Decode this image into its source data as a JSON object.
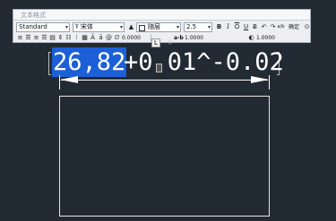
{
  "toolbar": {
    "title": "文本格式",
    "style_value": "Standard",
    "font_value": "宋体",
    "color_value": "随层",
    "height_value": "2.5",
    "bold_label": "B",
    "italic_label": "I",
    "overline_label": "O",
    "underline_label": "U",
    "undo_label": "↶",
    "redo_label": "↷",
    "stack_label": "a/b",
    "ok_label": "确定",
    "options_label": "⊙",
    "oblique_value": "0.0000",
    "tracking_prefix": "a-b",
    "tracking_value": "1.0000",
    "width_value": "1.0000",
    "ruler_tab_left": "L",
    "ruler_tab_right": "◇"
  },
  "editor": {
    "selected_text": "26,82",
    "rest_text": "+0.01^-0.02",
    "cursor_glyph": "⎕"
  },
  "colors": {
    "background": "#222a33",
    "selection": "#1c5fd6"
  }
}
